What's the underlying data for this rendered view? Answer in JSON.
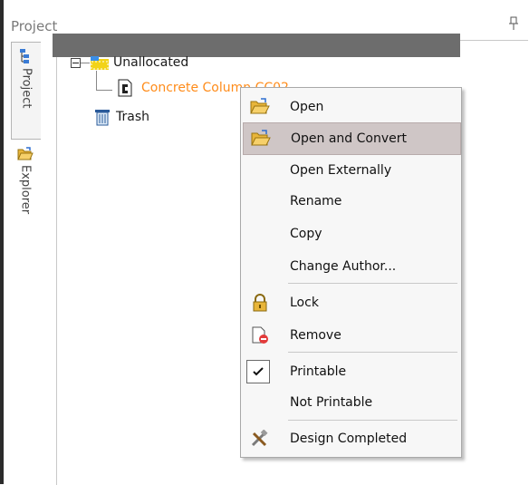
{
  "panel": {
    "title": "Project",
    "pin_icon": "pin-icon"
  },
  "side_tabs": [
    {
      "label": "Project",
      "icon": "project-tree-icon",
      "active": true
    },
    {
      "label": "Explorer",
      "icon": "folder-open-icon",
      "active": false
    }
  ],
  "tree": {
    "nodes": [
      {
        "label": "Unallocated",
        "icon": "folder-group-icon",
        "expanded": true
      },
      {
        "label": "Concrete Column CC02",
        "icon": "drawing-file-icon",
        "selected": true
      },
      {
        "label": "Trash",
        "icon": "trash-icon"
      }
    ]
  },
  "context_menu": {
    "items": [
      {
        "label": "Open",
        "icon": "folder-open-icon"
      },
      {
        "label": "Open and Convert",
        "icon": "folder-open-icon",
        "hovered": true
      },
      {
        "label": "Open Externally"
      },
      {
        "label": "Rename"
      },
      {
        "label": "Copy"
      },
      {
        "label": "Change Author..."
      },
      {
        "label": "Lock",
        "icon": "lock-icon"
      },
      {
        "label": "Remove",
        "icon": "remove-file-icon"
      },
      {
        "label": "Printable",
        "checked": true
      },
      {
        "label": "Not Printable"
      },
      {
        "label": "Design Completed",
        "icon": "tools-icon"
      }
    ]
  },
  "colors": {
    "selection_bg": "#6d6d6d",
    "selected_text": "#ff8c1a",
    "menu_hover": "#cfc6c6"
  }
}
